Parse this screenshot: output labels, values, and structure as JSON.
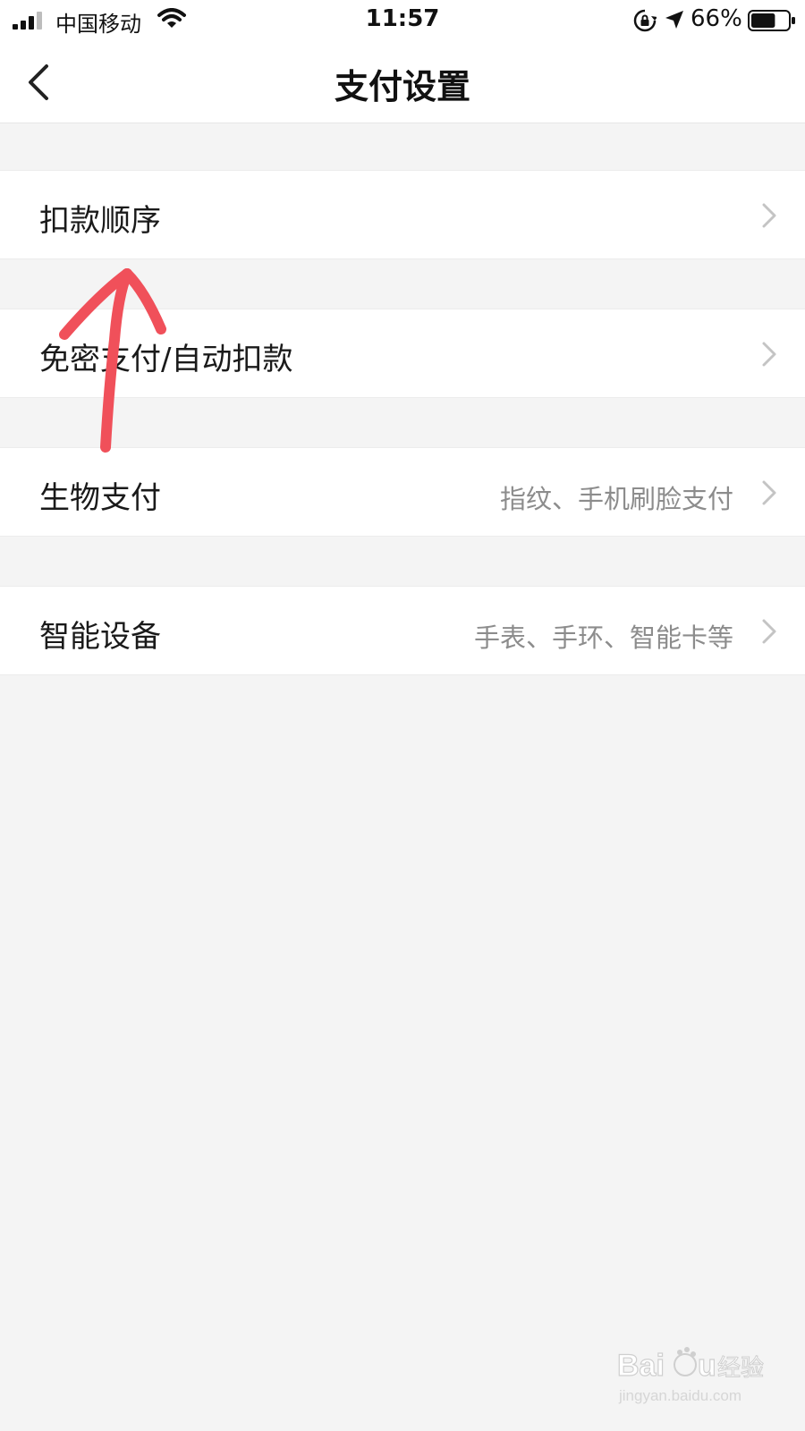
{
  "status_bar": {
    "carrier": "中国移动",
    "time": "11:57",
    "battery_percent": "66%",
    "battery_level": 0.66,
    "icons": [
      "signal-icon",
      "wifi-icon",
      "rotation-lock-icon",
      "location-arrow-icon",
      "battery-icon"
    ]
  },
  "nav": {
    "title": "支付设置",
    "back_icon": "chevron-left-icon"
  },
  "settings": [
    {
      "label": "扣款顺序",
      "detail": ""
    },
    {
      "label": "免密支付/自动扣款",
      "detail": ""
    },
    {
      "label": "生物支付",
      "detail": "指纹、手机刷脸支付"
    },
    {
      "label": "智能设备",
      "detail": "手表、手环、智能卡等"
    }
  ],
  "annotation": {
    "type": "hand-drawn-arrow",
    "color": "#f0505a"
  },
  "watermark": {
    "brand": "Baidu经验",
    "url": "jingyan.baidu.com"
  },
  "colors": {
    "background": "#f4f4f4",
    "row_background": "#ffffff",
    "detail_text": "#8c8c8c",
    "chevron": "#c4c4c4"
  }
}
